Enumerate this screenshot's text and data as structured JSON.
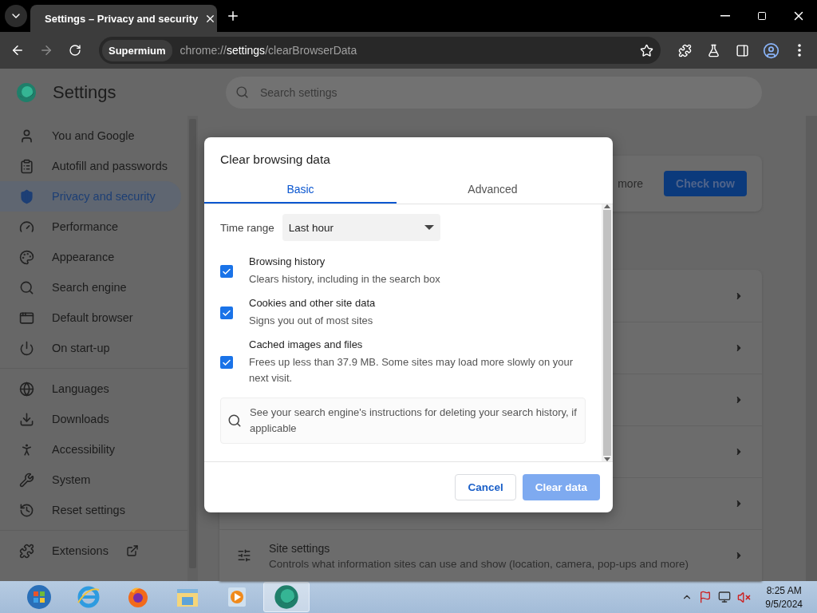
{
  "browser": {
    "tab": {
      "title": "Settings – Privacy and security"
    },
    "omnibox": {
      "badge": "Supermium",
      "url_scheme": "chrome://",
      "url_host": "settings",
      "url_path": "/clearBrowserData"
    }
  },
  "settings": {
    "title": "Settings",
    "search": {
      "placeholder": "Search settings"
    },
    "sidebar": {
      "groups": [
        [
          {
            "label": "You and Google",
            "selected": false
          },
          {
            "label": "Autofill and passwords",
            "selected": false
          },
          {
            "label": "Privacy and security",
            "selected": true
          },
          {
            "label": "Performance",
            "selected": false
          },
          {
            "label": "Appearance",
            "selected": false
          },
          {
            "label": "Search engine",
            "selected": false
          },
          {
            "label": "Default browser",
            "selected": false
          },
          {
            "label": "On start-up",
            "selected": false
          }
        ],
        [
          {
            "label": "Languages",
            "selected": false
          },
          {
            "label": "Downloads",
            "selected": false
          },
          {
            "label": "Accessibility",
            "selected": false
          },
          {
            "label": "System",
            "selected": false
          },
          {
            "label": "Reset settings",
            "selected": false
          }
        ],
        [
          {
            "label": "Extensions",
            "selected": false
          }
        ]
      ]
    },
    "safety_check": {
      "text": "more",
      "button": "Check now"
    },
    "site_settings": {
      "title": "Site settings",
      "description": "Controls what information sites can use and show (location, camera, pop-ups and more)"
    }
  },
  "dialog": {
    "title": "Clear browsing data",
    "tabs": [
      {
        "label": "Basic",
        "selected": true
      },
      {
        "label": "Advanced",
        "selected": false
      }
    ],
    "time_range": {
      "label": "Time range",
      "value": "Last hour"
    },
    "options": [
      {
        "title": "Browsing history",
        "description": "Clears history, including in the search box",
        "checked": true
      },
      {
        "title": "Cookies and other site data",
        "description": "Signs you out of most sites",
        "checked": true
      },
      {
        "title": "Cached images and files",
        "description": "Frees up less than 37.9 MB. Some sites may load more slowly on your next visit.",
        "checked": true
      }
    ],
    "info": "See your search engine's instructions for deleting your search history, if applicable",
    "buttons": {
      "cancel": "Cancel",
      "confirm": "Clear data"
    }
  },
  "taskbar": {
    "time": "8:25 AM",
    "date": "9/5/2024"
  }
}
